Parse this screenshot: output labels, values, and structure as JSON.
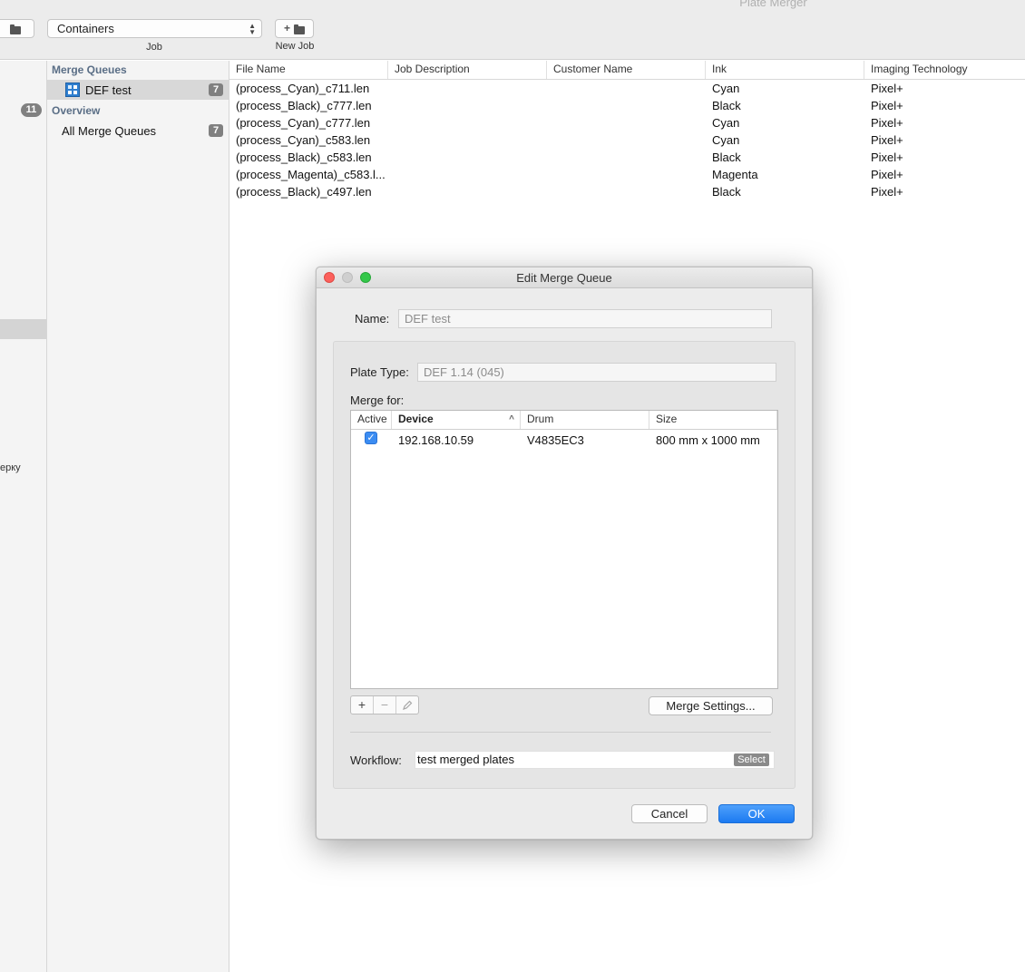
{
  "window": {
    "title": "Plate Merger"
  },
  "toolbar": {
    "job_select_value": "Containers",
    "job_label": "Job",
    "new_job_label": "New Job"
  },
  "left_strip": {
    "badge_count": "11",
    "partial_text": "ерку"
  },
  "sidebar": {
    "merge_queues_header": "Merge Queues",
    "queue_item": {
      "label": "DEF test",
      "count": "7"
    },
    "overview_header": "Overview",
    "all_queues_item": {
      "label": "All Merge Queues",
      "count": "7"
    }
  },
  "table": {
    "columns": [
      "File Name",
      "Job Description",
      "Customer Name",
      "Ink",
      "Imaging Technology"
    ],
    "rows": [
      {
        "file_name": "(process_Cyan)_c711.len",
        "job_description": "",
        "customer_name": "",
        "ink": "Cyan",
        "imaging": "Pixel+"
      },
      {
        "file_name": "(process_Black)_c777.len",
        "job_description": "",
        "customer_name": "",
        "ink": "Black",
        "imaging": "Pixel+"
      },
      {
        "file_name": "(process_Cyan)_c777.len",
        "job_description": "",
        "customer_name": "",
        "ink": "Cyan",
        "imaging": "Pixel+"
      },
      {
        "file_name": "(process_Cyan)_c583.len",
        "job_description": "",
        "customer_name": "",
        "ink": "Cyan",
        "imaging": "Pixel+"
      },
      {
        "file_name": "(process_Black)_c583.len",
        "job_description": "",
        "customer_name": "",
        "ink": "Black",
        "imaging": "Pixel+"
      },
      {
        "file_name": "(process_Magenta)_c583.l...",
        "job_description": "",
        "customer_name": "",
        "ink": "Magenta",
        "imaging": "Pixel+"
      },
      {
        "file_name": "(process_Black)_c497.len",
        "job_description": "",
        "customer_name": "",
        "ink": "Black",
        "imaging": "Pixel+"
      }
    ]
  },
  "dialog": {
    "title": "Edit Merge Queue",
    "name_label": "Name:",
    "name_value": "DEF test",
    "plate_type_label": "Plate Type:",
    "plate_type_value": "DEF 1.14 (045)",
    "merge_for_label": "Merge for:",
    "merge_table": {
      "columns": [
        "Active",
        "Device",
        "Drum",
        "Size"
      ],
      "sort_indicator": "^",
      "rows": [
        {
          "active": true,
          "device": "192.168.10.59",
          "drum": "V4835EC3",
          "size": "800 mm x 1000 mm"
        }
      ]
    },
    "add_symbol": "+",
    "remove_symbol": "−",
    "merge_settings_label": "Merge Settings...",
    "workflow_label": "Workflow:",
    "workflow_value": "test merged plates",
    "select_label": "Select",
    "cancel_label": "Cancel",
    "ok_label": "OK"
  },
  "colors": {
    "accent_blue": "#1c7af1",
    "section_header": "#5a6e86",
    "badge_gray": "#808080",
    "close_red": "#fc605c",
    "maximize_green": "#34c84a"
  }
}
